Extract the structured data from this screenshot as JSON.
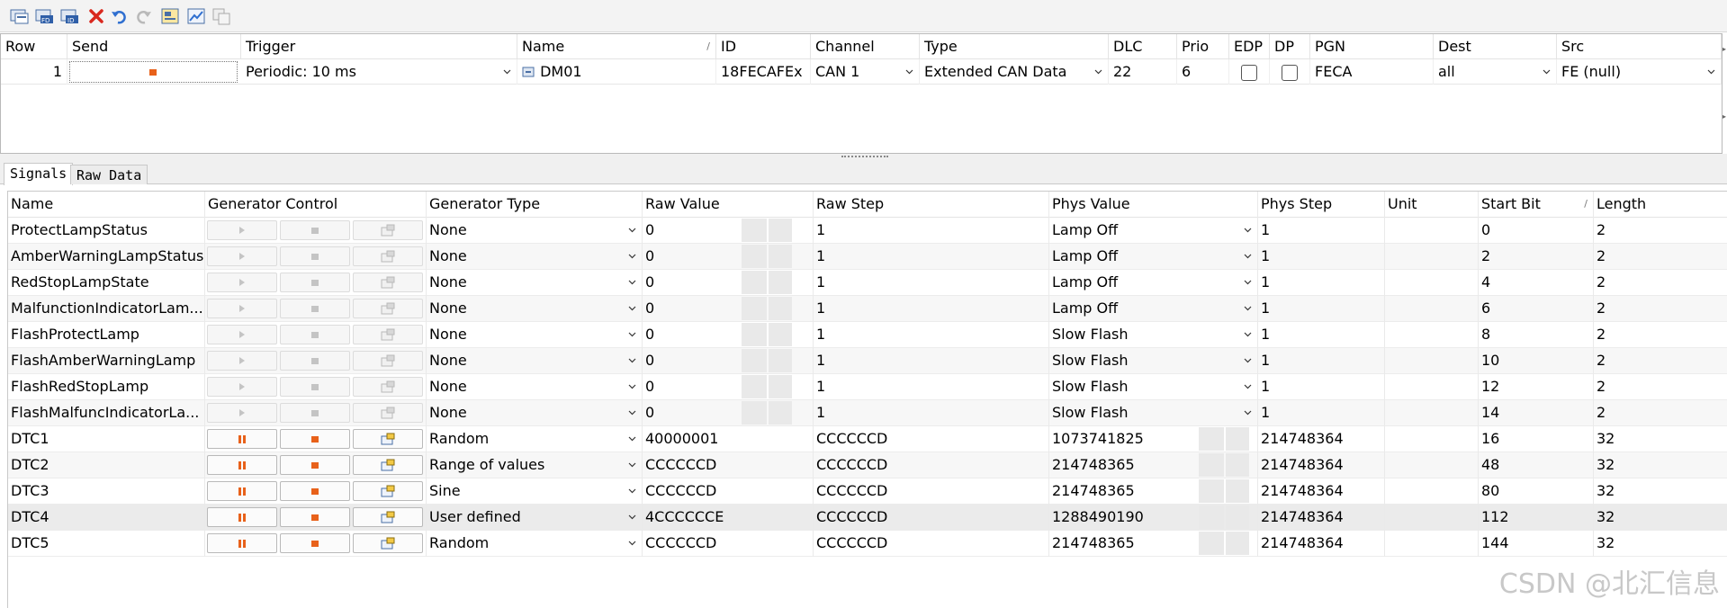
{
  "toolbar": {
    "buttons": [
      {
        "name": "add-message-icon"
      },
      {
        "name": "add-fd-message-icon"
      },
      {
        "name": "add-id-message-icon"
      },
      {
        "name": "delete-icon"
      },
      {
        "name": "undo-icon"
      },
      {
        "name": "redo-icon"
      },
      {
        "name": "import-icon"
      },
      {
        "name": "chart-icon"
      },
      {
        "name": "copy-icon"
      }
    ]
  },
  "message_table": {
    "columns": [
      "Row",
      "Send",
      "Trigger",
      "Name",
      "ID",
      "Channel",
      "Type",
      "DLC",
      "Prio",
      "EDP",
      "DP",
      "PGN",
      "Dest",
      "Src"
    ],
    "row": {
      "row": "1",
      "trigger": "Periodic: 10 ms",
      "name": "DM01",
      "id": "18FECAFEx",
      "channel": "CAN 1",
      "type": "Extended CAN Data",
      "dlc": "22",
      "prio": "6",
      "pgn": "FECA",
      "dest": "all",
      "src": "FE (null)"
    }
  },
  "tabs": {
    "signals": "Signals",
    "raw_data": "Raw Data"
  },
  "signal_table": {
    "columns": {
      "name": "Name",
      "generator_control": "Generator Control",
      "generator_type": "Generator Type",
      "raw_value": "Raw Value",
      "raw_step": "Raw Step",
      "phys_value": "Phys Value",
      "phys_step": "Phys Step",
      "unit": "Unit",
      "start_bit": "Start Bit",
      "length": "Length"
    },
    "rows": [
      {
        "name": "ProtectLampStatus",
        "gen_type": "None",
        "raw_value": "0",
        "raw_step": "1",
        "phys_value": "Lamp Off",
        "phys_step": "1",
        "unit": "",
        "start_bit": "0",
        "length": "2"
      },
      {
        "name": "AmberWarningLampStatus",
        "gen_type": "None",
        "raw_value": "0",
        "raw_step": "1",
        "phys_value": "Lamp Off",
        "phys_step": "1",
        "unit": "",
        "start_bit": "2",
        "length": "2"
      },
      {
        "name": "RedStopLampState",
        "gen_type": "None",
        "raw_value": "0",
        "raw_step": "1",
        "phys_value": "Lamp Off",
        "phys_step": "1",
        "unit": "",
        "start_bit": "4",
        "length": "2"
      },
      {
        "name": "MalfunctionIndicatorLam...",
        "gen_type": "None",
        "raw_value": "0",
        "raw_step": "1",
        "phys_value": "Lamp Off",
        "phys_step": "1",
        "unit": "",
        "start_bit": "6",
        "length": "2"
      },
      {
        "name": "FlashProtectLamp",
        "gen_type": "None",
        "raw_value": "0",
        "raw_step": "1",
        "phys_value": "Slow Flash",
        "phys_step": "1",
        "unit": "",
        "start_bit": "8",
        "length": "2"
      },
      {
        "name": "FlashAmberWarningLamp",
        "gen_type": "None",
        "raw_value": "0",
        "raw_step": "1",
        "phys_value": "Slow Flash",
        "phys_step": "1",
        "unit": "",
        "start_bit": "10",
        "length": "2"
      },
      {
        "name": "FlashRedStopLamp",
        "gen_type": "None",
        "raw_value": "0",
        "raw_step": "1",
        "phys_value": "Slow Flash",
        "phys_step": "1",
        "unit": "",
        "start_bit": "12",
        "length": "2"
      },
      {
        "name": "FlashMalfuncIndicatorLa...",
        "gen_type": "None",
        "raw_value": "0",
        "raw_step": "1",
        "phys_value": "Slow Flash",
        "phys_step": "1",
        "unit": "",
        "start_bit": "14",
        "length": "2"
      },
      {
        "name": "DTC1",
        "gen_type": "Random",
        "raw_value": "40000001",
        "raw_step": "CCCCCCD",
        "phys_value": "1073741825",
        "phys_step": "214748364",
        "unit": "",
        "start_bit": "16",
        "length": "32"
      },
      {
        "name": "DTC2",
        "gen_type": "Range of values",
        "raw_value": "CCCCCCD",
        "raw_step": "CCCCCCD",
        "phys_value": "214748365",
        "phys_step": "214748364",
        "unit": "",
        "start_bit": "48",
        "length": "32"
      },
      {
        "name": "DTC3",
        "gen_type": "Sine",
        "raw_value": "CCCCCCD",
        "raw_step": "CCCCCCD",
        "phys_value": "214748365",
        "phys_step": "214748364",
        "unit": "",
        "start_bit": "80",
        "length": "32"
      },
      {
        "name": "DTC4",
        "gen_type": "User defined",
        "raw_value": "4CCCCCCE",
        "raw_step": "CCCCCCD",
        "phys_value": "1288490190",
        "phys_step": "214748364",
        "unit": "",
        "start_bit": "112",
        "length": "32"
      },
      {
        "name": "DTC5",
        "gen_type": "Random",
        "raw_value": "CCCCCCD",
        "raw_step": "CCCCCCD",
        "phys_value": "214748365",
        "phys_step": "214748364",
        "unit": "",
        "start_bit": "144",
        "length": "32"
      }
    ]
  },
  "watermark": "CSDN @北汇信息",
  "colors": {
    "accent_orange": "#e8611a",
    "undo_blue": "#2f6fd0",
    "delete_red": "#d9281e"
  }
}
